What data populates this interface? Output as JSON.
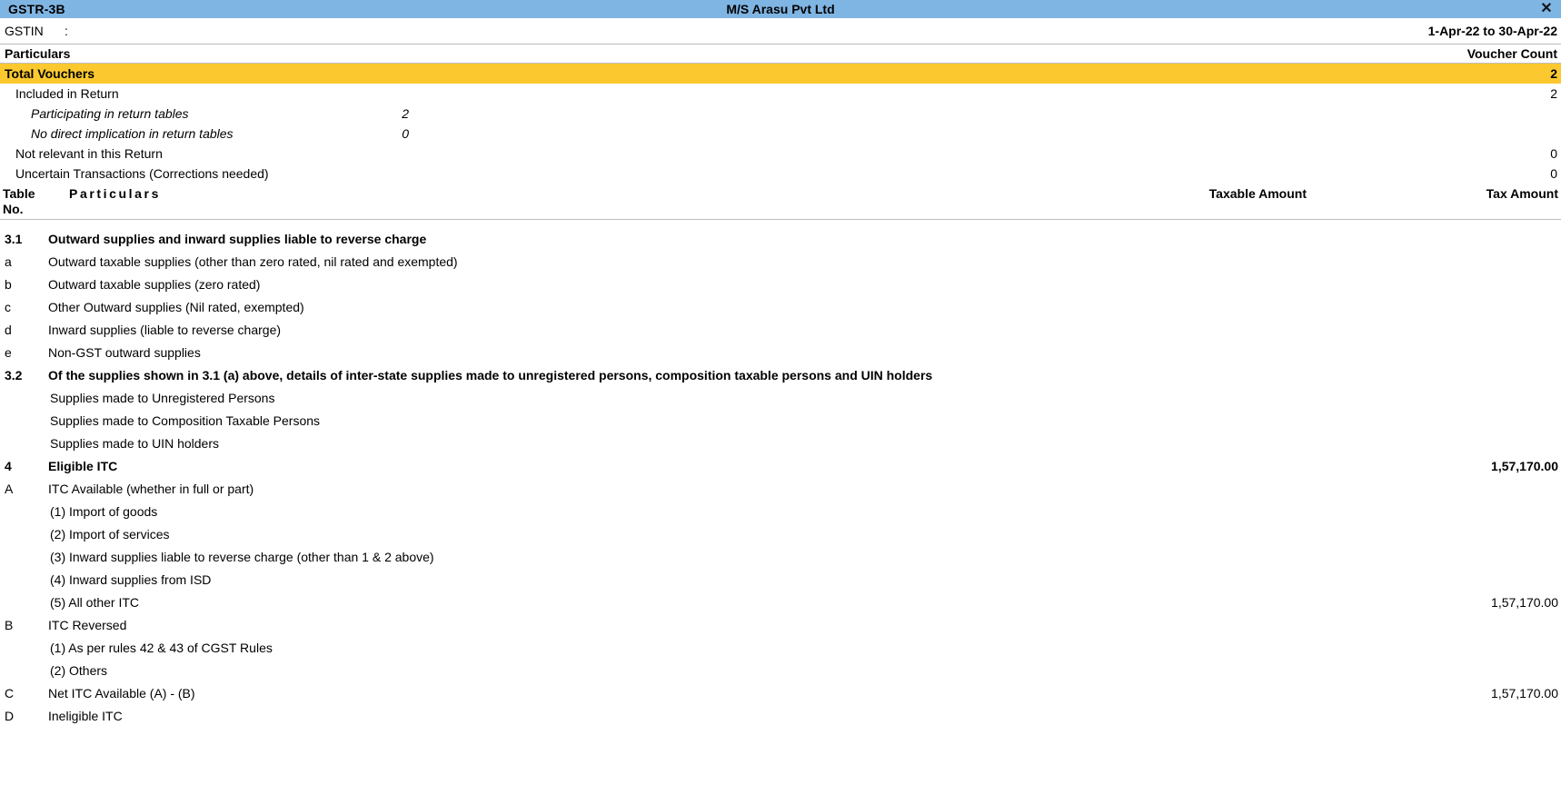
{
  "window": {
    "title": "GSTR-3B",
    "company": "M/S Arasu  Pvt Ltd",
    "close_icon": "close-icon",
    "close_glyph": "✕",
    "titlebar_color": "#7FB5E3",
    "highlight_color": "#FBC92F"
  },
  "gstin": {
    "label": "GSTIN",
    "colon": ":",
    "value": "",
    "period": "1-Apr-22 to 30-Apr-22"
  },
  "summary_header": {
    "left": "Particulars",
    "right": "Voucher Count"
  },
  "summary_rows": [
    {
      "label": "Total Vouchers",
      "mid": "",
      "right": "2",
      "level": 0,
      "highlight": true,
      "bold": true
    },
    {
      "label": "Included in Return",
      "mid": "",
      "right": "2",
      "level": 1,
      "highlight": false,
      "bold": false
    },
    {
      "label": "Participating in return tables",
      "mid": "2",
      "right": "",
      "level": 2,
      "highlight": false,
      "bold": false
    },
    {
      "label": "No direct implication in return tables",
      "mid": "0",
      "right": "",
      "level": 2,
      "highlight": false,
      "bold": false
    },
    {
      "label": "Not relevant in this Return",
      "mid": "",
      "right": "0",
      "level": 1,
      "highlight": false,
      "bold": false
    },
    {
      "label": "Uncertain Transactions (Corrections needed)",
      "mid": "",
      "right": "0",
      "level": 1,
      "highlight": false,
      "bold": false
    }
  ],
  "table_header": {
    "table_no": "Table No.",
    "particulars": "Particulars",
    "taxable_amount": "Taxable Amount",
    "tax_amount": "Tax Amount"
  },
  "table_rows": [
    {
      "code": "3.1",
      "text": "Outward supplies and inward supplies liable to reverse charge",
      "taxable": "",
      "tax": "",
      "bold": true,
      "indent": 0
    },
    {
      "code": "a",
      "text": "Outward taxable supplies (other than zero rated, nil rated and exempted)",
      "taxable": "",
      "tax": "",
      "bold": false,
      "indent": 0
    },
    {
      "code": "b",
      "text": "Outward taxable supplies (zero rated)",
      "taxable": "",
      "tax": "",
      "bold": false,
      "indent": 0
    },
    {
      "code": "c",
      "text": "Other Outward supplies (Nil rated, exempted)",
      "taxable": "",
      "tax": "",
      "bold": false,
      "indent": 0
    },
    {
      "code": "d",
      "text": "Inward supplies (liable to reverse charge)",
      "taxable": "",
      "tax": "",
      "bold": false,
      "indent": 0
    },
    {
      "code": "e",
      "text": "Non-GST outward supplies",
      "taxable": "",
      "tax": "",
      "bold": false,
      "indent": 0
    },
    {
      "code": "3.2",
      "text": "Of the supplies shown in 3.1 (a) above, details of inter-state supplies made to unregistered persons, composition taxable persons and UIN holders",
      "taxable": "",
      "tax": "",
      "bold": true,
      "indent": 0
    },
    {
      "code": "",
      "text": "Supplies made to Unregistered Persons",
      "taxable": "",
      "tax": "",
      "bold": false,
      "indent": 1
    },
    {
      "code": "",
      "text": "Supplies made to Composition Taxable Persons",
      "taxable": "",
      "tax": "",
      "bold": false,
      "indent": 1
    },
    {
      "code": "",
      "text": "Supplies made to UIN holders",
      "taxable": "",
      "tax": "",
      "bold": false,
      "indent": 1
    },
    {
      "code": "4",
      "text": "Eligible ITC",
      "taxable": "",
      "tax": "1,57,170.00",
      "bold": true,
      "indent": 0
    },
    {
      "code": "A",
      "text": "ITC Available (whether in full or part)",
      "taxable": "",
      "tax": "",
      "bold": false,
      "indent": 0
    },
    {
      "code": "",
      "text": "(1) Import of goods",
      "taxable": "",
      "tax": "",
      "bold": false,
      "indent": 1
    },
    {
      "code": "",
      "text": "(2) Import of services",
      "taxable": "",
      "tax": "",
      "bold": false,
      "indent": 1
    },
    {
      "code": "",
      "text": "(3) Inward supplies liable to reverse charge (other than 1 & 2 above)",
      "taxable": "",
      "tax": "",
      "bold": false,
      "indent": 1
    },
    {
      "code": "",
      "text": "(4) Inward supplies from ISD",
      "taxable": "",
      "tax": "",
      "bold": false,
      "indent": 1
    },
    {
      "code": "",
      "text": "(5) All other ITC",
      "taxable": "",
      "tax": "1,57,170.00",
      "bold": false,
      "indent": 1
    },
    {
      "code": "B",
      "text": "ITC Reversed",
      "taxable": "",
      "tax": "",
      "bold": false,
      "indent": 0
    },
    {
      "code": "",
      "text": "(1) As per rules 42 & 43 of CGST Rules",
      "taxable": "",
      "tax": "",
      "bold": false,
      "indent": 1
    },
    {
      "code": "",
      "text": "(2) Others",
      "taxable": "",
      "tax": "",
      "bold": false,
      "indent": 1
    },
    {
      "code": "C",
      "text": "Net ITC Available (A) - (B)",
      "taxable": "",
      "tax": "1,57,170.00",
      "bold": false,
      "indent": 0
    },
    {
      "code": "D",
      "text": "Ineligible ITC",
      "taxable": "",
      "tax": "",
      "bold": false,
      "indent": 0
    }
  ]
}
